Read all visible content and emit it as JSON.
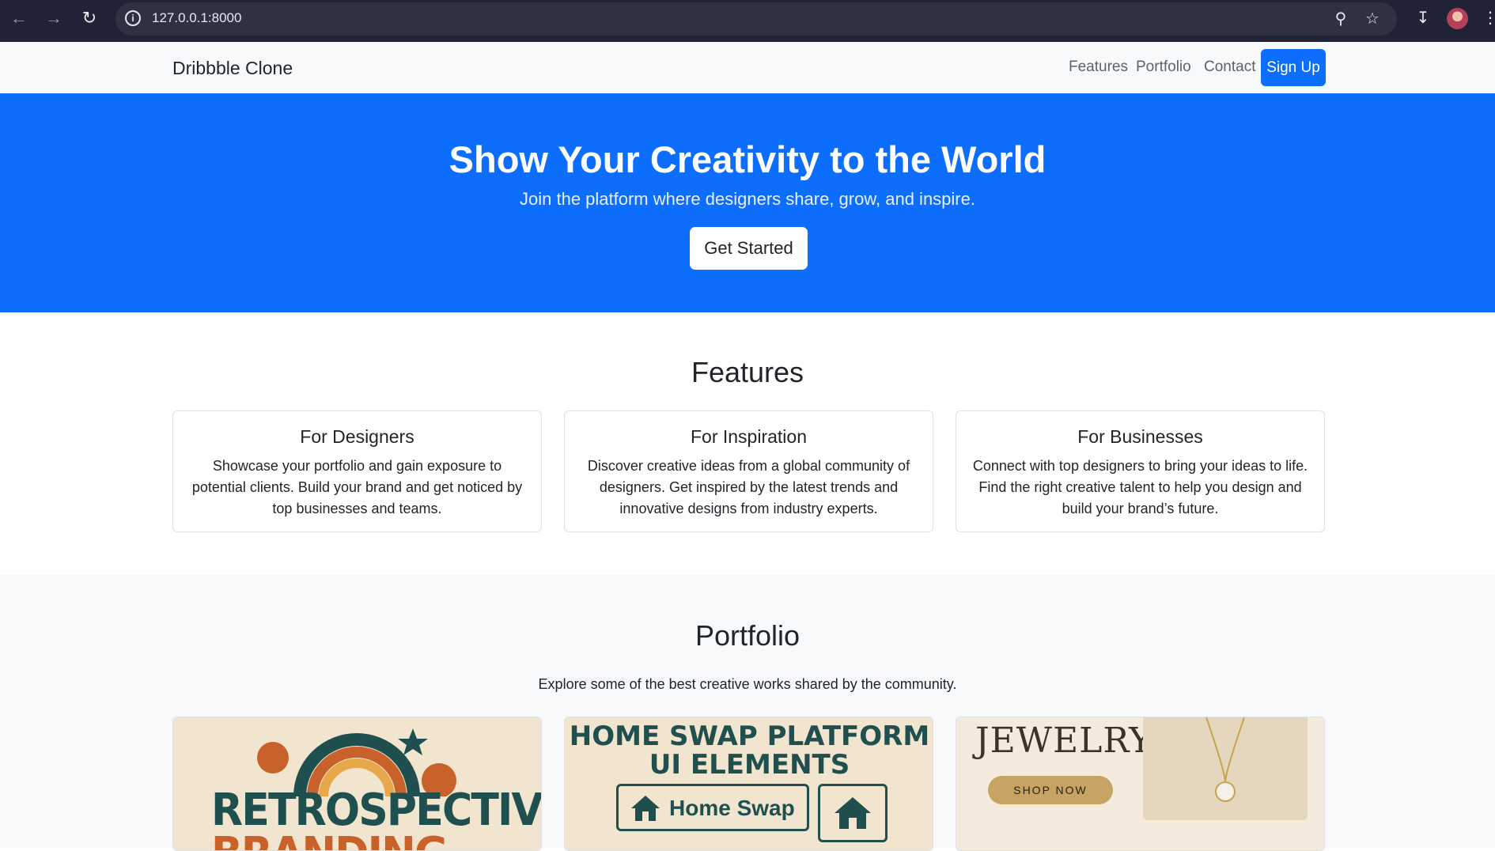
{
  "browser": {
    "url": "127.0.0.1:8000"
  },
  "navbar": {
    "brand": "Dribbble Clone",
    "links": [
      "Features",
      "Portfolio",
      "Contact"
    ],
    "signup": "Sign Up"
  },
  "hero": {
    "title": "Show Your Creativity to the World",
    "subtitle": "Join the platform where designers share, grow, and inspire.",
    "cta": "Get Started"
  },
  "features": {
    "title": "Features",
    "cards": [
      {
        "title": "For Designers",
        "text": "Showcase your portfolio and gain exposure to potential clients. Build your brand and get noticed by top businesses and teams."
      },
      {
        "title": "For Inspiration",
        "text": "Discover creative ideas from a global community of designers. Get inspired by the latest trends and innovative designs from industry experts."
      },
      {
        "title": "For Businesses",
        "text": "Connect with top designers to bring your ideas to life. Find the right creative talent to help you design and build your brand’s future."
      }
    ]
  },
  "portfolio": {
    "title": "Portfolio",
    "lead": "Explore some of the best creative works shared by the community.",
    "items": [
      {
        "heading": "RETROSPECTIVE",
        "subheading": "BRANDING"
      },
      {
        "heading": "HOME SWAP PLATFORM UI ELEMENTS",
        "button": "Home Swap"
      },
      {
        "heading": "JEWELRY",
        "button": "SHOP NOW"
      }
    ]
  },
  "colors": {
    "primary": "#0d6efd",
    "chrome": "#1f2335",
    "teal": "#1f4f4e",
    "orange": "#c8612a"
  }
}
